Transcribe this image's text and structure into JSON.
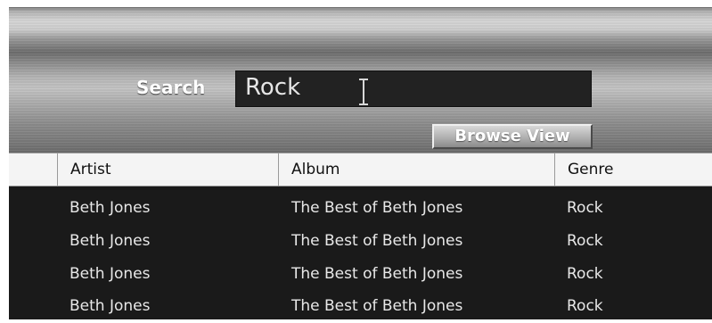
{
  "search": {
    "label": "Search",
    "value": "Rock"
  },
  "toolbar": {
    "browse_view_label": "Browse View"
  },
  "table": {
    "columns": [
      "Artist",
      "Album",
      "Genre"
    ],
    "rows": [
      [
        "Beth Jones",
        "The Best of Beth Jones",
        "Rock"
      ],
      [
        "Beth Jones",
        "The Best of Beth Jones",
        "Rock"
      ],
      [
        "Beth Jones",
        "The Best of Beth Jones",
        "Rock"
      ],
      [
        "Beth Jones",
        "The Best of Beth Jones",
        "Rock"
      ]
    ]
  },
  "icons": {
    "cursor": "text-cursor-ibeam-icon"
  },
  "colors": {
    "toolbar": "#a8a8a8",
    "search_box": "#222222",
    "list_background": "#1a1a1a",
    "list_text": "#e8e8e8",
    "header_background": "#f4f4f4"
  }
}
